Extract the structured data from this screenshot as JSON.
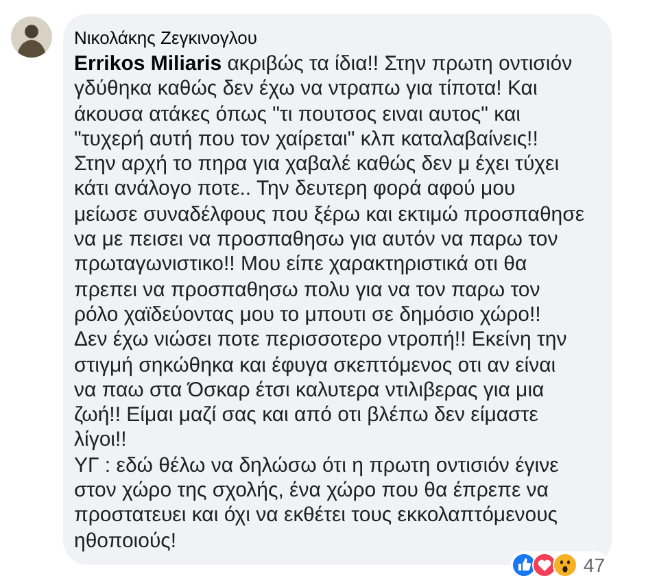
{
  "comment": {
    "author": "Νικολάκης Ζεγκινογλου",
    "mention": "Errikos Miliaris",
    "text": " ακριβώς τα ίδια!! Στην πρωτη οντισιόν\nγδύθηκα καθώς δεν έχω να ντραπω για τίποτα! Και\nάκουσα ατάκες όπως \"τι πουτσος ειναι αυτος\" και\n\"τυχερή αυτή που τον χαίρεται\" κλπ καταλαβαίνεις!!\nΣτην αρχή το πηρα για χαβαλέ καθώς δεν μ έχει τύχει\nκάτι ανάλογο ποτε.. Την δευτερη φορά αφού μου\nμείωσε συναδέλφους που ξέρω και εκτιμώ προσπαθησε\nνα με πεισει να προσπαθησω για αυτόν να παρω τον\nπρωταγωνιστικο!! Μου είπε χαρακτηριστικά οτι θα\nπρεπει να προσπαθησω πολυ για να τον παρω τον\nρόλο χαϊδεύοντας μου το μπουτι σε δημόσιο χώρο!!\nΔεν έχω νιώσει ποτε περισσοτερο ντροπή!! Εκείνη την\nστιγμή σηκώθηκα και έφυγα σκεπτόμενος οτι αν είναι\nνα παω στα Όσκαρ έτσι καλυτερα ντιλιβερας για μια\nζωή!! Είμαι μαζί σας και από οτι βλέπω δεν είμαστε\nλίγοι!!\nΥΓ : εδώ θέλω να δηλώσω ότι η πρωτη οντισιόν έγινε\nστον χώρο της σχολής, ένα χώρο που θα έπρεπε να\nπροστατευει και όχι να εκθέτει τους εκκολαπτόμενους\nηθοποιούς!",
    "reactions": [
      {
        "kind": "like"
      },
      {
        "kind": "love"
      },
      {
        "kind": "wow"
      }
    ],
    "reaction_count": "47"
  }
}
